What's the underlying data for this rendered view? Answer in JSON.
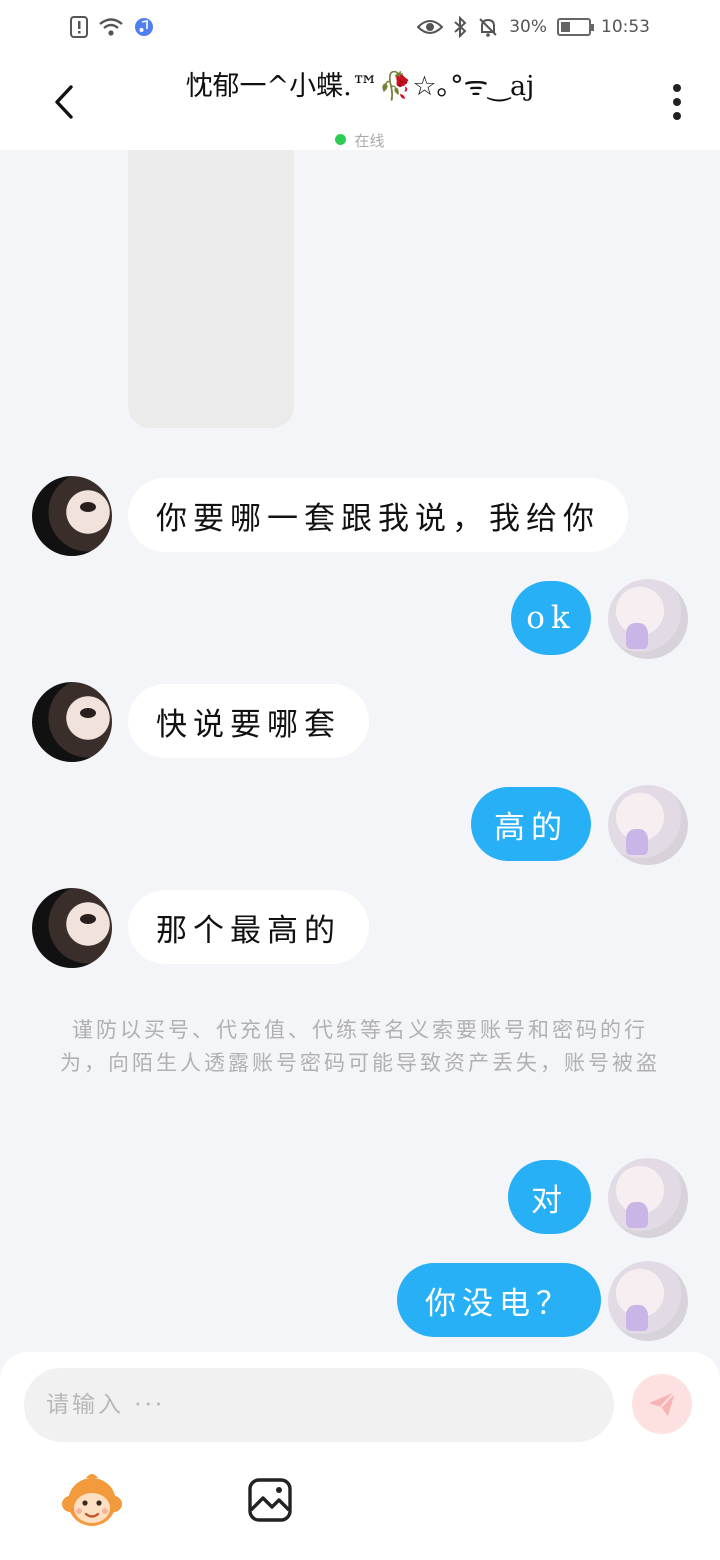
{
  "status_bar": {
    "battery": "30%",
    "battery_level": 0.3,
    "time": "10:53",
    "icons_left": [
      "sim-alert-icon",
      "wifi-icon",
      "music-app-icon"
    ],
    "icons_right": [
      "eye-icon",
      "bluetooth-icon",
      "mute-bell-icon",
      "battery-icon"
    ]
  },
  "header": {
    "title": "忱郁一^小蝶.™🥀☆｡°ᯤ‿aj",
    "status": "在线",
    "status_color": "#2ecc55"
  },
  "messages": [
    {
      "side": "in",
      "text": "你要哪一套跟我说，我给你"
    },
    {
      "side": "out",
      "text": "ok"
    },
    {
      "side": "in",
      "text": "快说要哪套"
    },
    {
      "side": "out",
      "text": "高的"
    },
    {
      "side": "in",
      "text": "那个最高的"
    },
    {
      "side": "out",
      "text": "对"
    },
    {
      "side": "out",
      "text": "你没电？"
    }
  ],
  "notice": "谨防以买号、代充值、代练等名义索要账号和密码的行为，向陌生人透露账号密码可能导致资产丢失，账号被盗",
  "composer": {
    "placeholder": "请输入 ···"
  },
  "colors": {
    "outgoing_bubble": "#27b0f6",
    "incoming_bubble": "#ffffff",
    "background": "#f3f5f8",
    "send_button": "#fde1e1"
  }
}
